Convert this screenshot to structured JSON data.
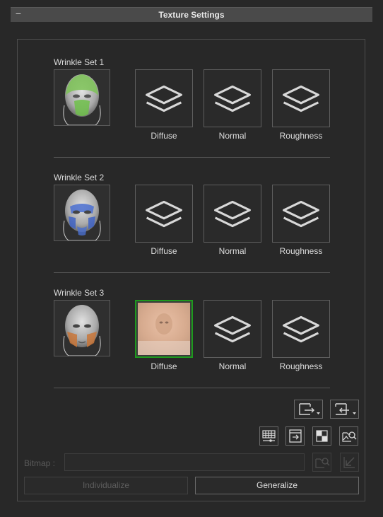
{
  "header": {
    "title": "Texture Settings",
    "collapse_glyph": "−"
  },
  "sets": [
    {
      "label": "Wrinkle Set 1",
      "preview_icon": "face-green-icon",
      "slots": [
        "Diffuse",
        "Normal",
        "Roughness"
      ]
    },
    {
      "label": "Wrinkle Set 2",
      "preview_icon": "face-blue-icon",
      "slots": [
        "Diffuse",
        "Normal",
        "Roughness"
      ]
    },
    {
      "label": "Wrinkle Set 3",
      "preview_icon": "face-orange-icon",
      "slots": [
        "Diffuse",
        "Normal",
        "Roughness"
      ]
    }
  ],
  "bitmap": {
    "label": "Bitmap :",
    "value": ""
  },
  "buttons": {
    "individualize": "Individualize",
    "generalize": "Generalize"
  },
  "colors": {
    "selected_border": "#1d9a1d",
    "green_mask": "#6fbf4a",
    "blue_mask": "#4a6fd0",
    "orange_mask": "#c9773a"
  }
}
